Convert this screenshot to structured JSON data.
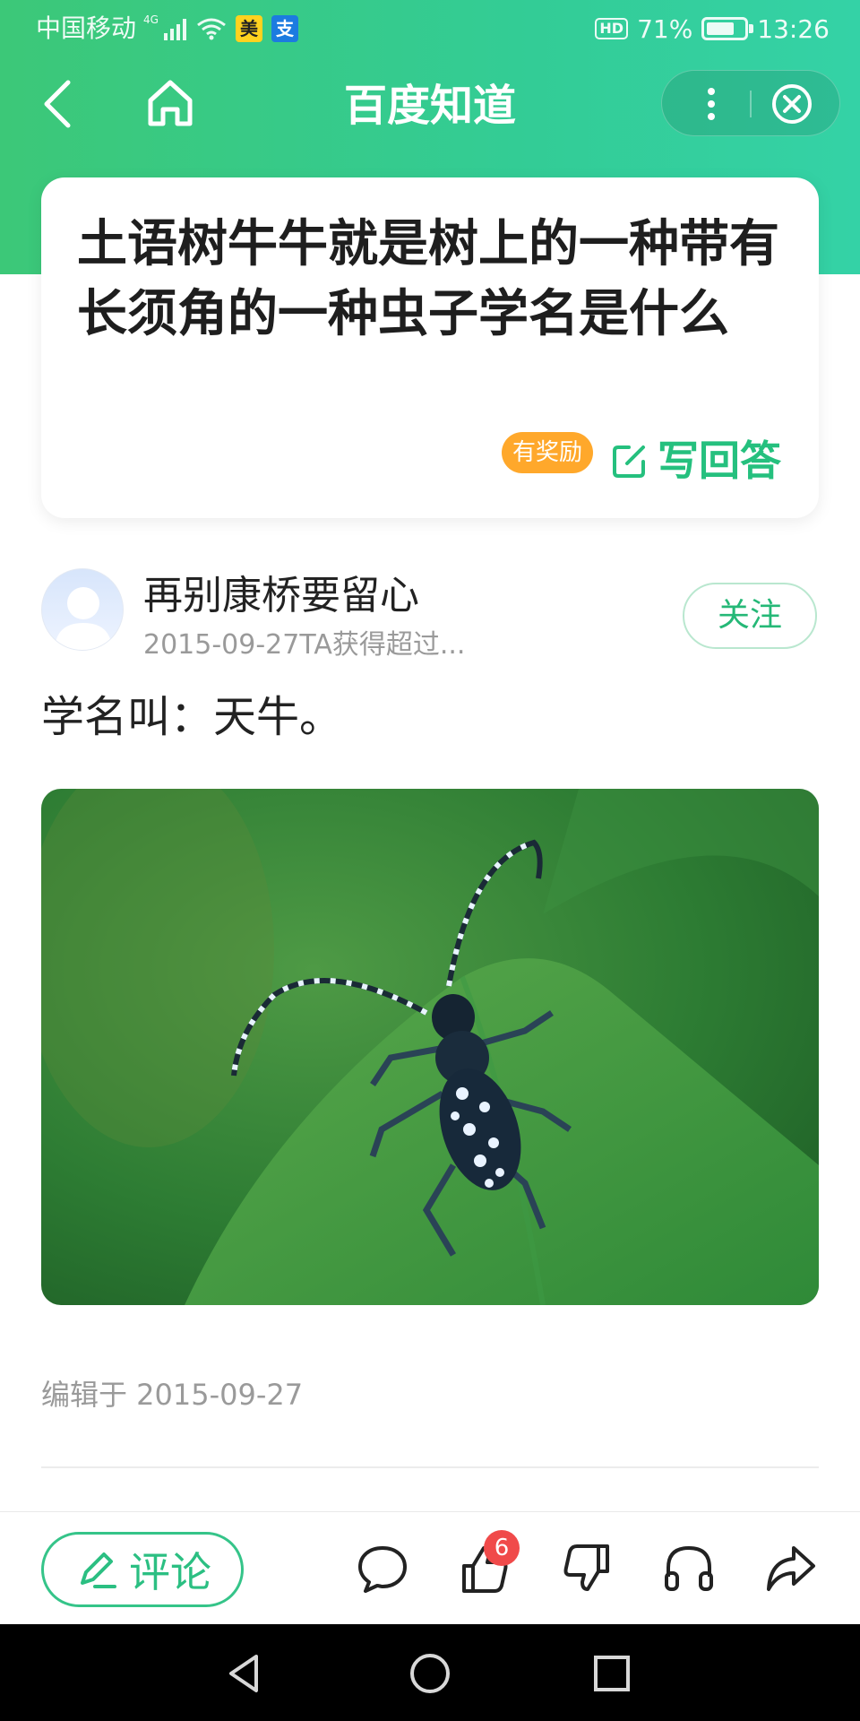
{
  "status_bar": {
    "carrier": "中国移动",
    "network": "4G",
    "app_badges": [
      "美",
      "支"
    ],
    "hd": "HD",
    "battery": "71%",
    "time": "13:26"
  },
  "nav": {
    "title": "百度知道"
  },
  "question": {
    "title": "土语树牛牛就是树上的一种带有长须角的一种虫子学名是什么",
    "reward_label": "有奖励",
    "write_answer_label": "写回答"
  },
  "answer": {
    "author_name": "再别康桥要留心",
    "author_meta": "2015-09-27TA获得超过...",
    "follow_label": "关注",
    "text": "学名叫：天牛。",
    "edited": "编辑于 2015-09-27"
  },
  "toolbar": {
    "comment_label": "评论",
    "like_count": "6"
  },
  "colors": {
    "brand_green": "#33cc8a",
    "reward_orange": "#ffa82b",
    "badge_red": "#f04a4a"
  },
  "icons": [
    "back-icon",
    "home-icon",
    "more-icon",
    "close-icon",
    "edit-icon",
    "pencil-icon",
    "chat-bubble-icon",
    "thumbs-up-icon",
    "thumbs-down-icon",
    "headphones-icon",
    "share-icon"
  ]
}
